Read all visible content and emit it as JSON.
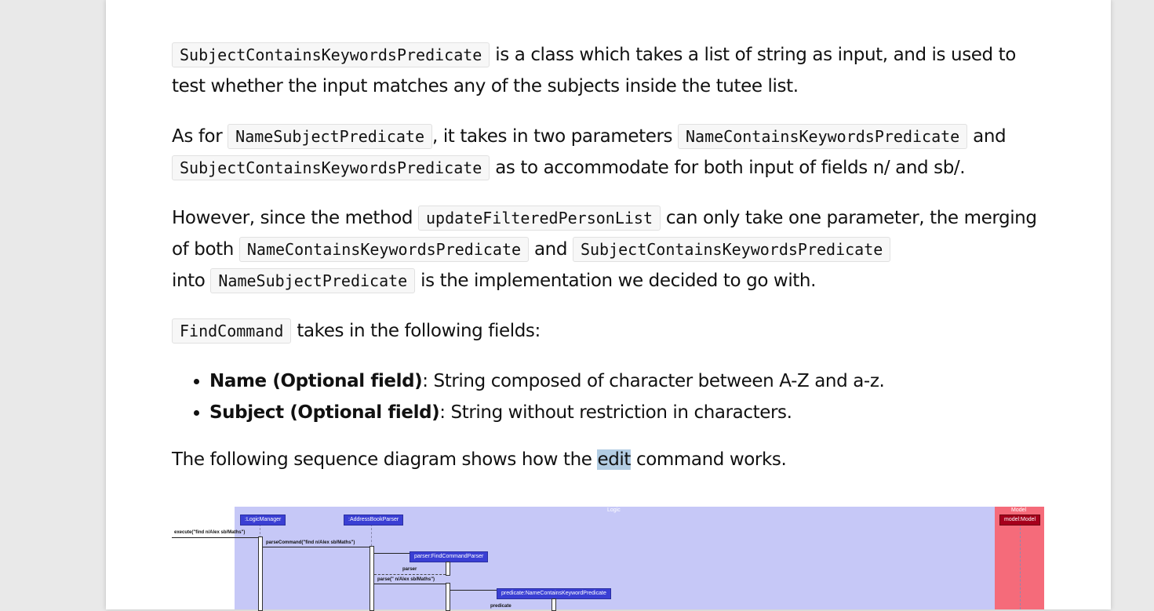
{
  "paragraphs": {
    "p1": {
      "code1": "SubjectContainsKeywordsPredicate",
      "text1": " is a class which takes a list of string as input, and is used to test whether the input matches any of the subjects inside the tutee list."
    },
    "p2": {
      "text1": "As for ",
      "code1": "NameSubjectPredicate",
      "text2": ", it takes in two parameters ",
      "code2": "NameContainsKeywordsPredicate",
      "text3": " and ",
      "code3": "SubjectContainsKeywordsPredicate",
      "text4": " as to accommodate for both input of fields n/ and sb/."
    },
    "p3": {
      "text1": "However, since the method ",
      "code1": "updateFilteredPersonList",
      "text2": " can only take one parameter, the merging of both ",
      "code2": "NameContainsKeywordsPredicate",
      "text3": " and ",
      "code3": "SubjectContainsKeywordsPredicate",
      "text4": " into ",
      "code4": "NameSubjectPredicate",
      "text5": " is the implementation we decided to go with."
    },
    "p4": {
      "code1": "FindCommand",
      "text1": " takes in the following fields:"
    },
    "fields": [
      {
        "label": "Name (Optional field)",
        "desc": ": String composed of character between A-Z and a-z."
      },
      {
        "label": "Subject (Optional field)",
        "desc": ": String without restriction in characters."
      }
    ],
    "p5": {
      "text1": "The following sequence diagram shows how the ",
      "highlight": "edit",
      "text2": " command works."
    }
  },
  "diagram": {
    "frames": {
      "logic": "Logic",
      "model": "Model"
    },
    "actors": {
      "logic_manager": ":LogicManager",
      "address_book_parser": ":AddressBookParser",
      "find_command_parser": "parser:FindCommandParser",
      "predicate": "predicate:NameContainsKeywordPredicate",
      "model": "model:Model"
    },
    "messages": {
      "execute": "execute(\"find n/Alex sb/Maths\")",
      "parse_command": "parseCommand(\"find n/Alex sb/Maths\")",
      "parser_return": "parser",
      "parse": "parse(\" n/Alex sb/Maths\")",
      "predicate_return": "predicate"
    },
    "colors": {
      "logic_frame": "#c6c8f7",
      "model_frame": "#f56b7a",
      "actor": "#3a3fd4",
      "model_actor": "#a6001c"
    }
  }
}
